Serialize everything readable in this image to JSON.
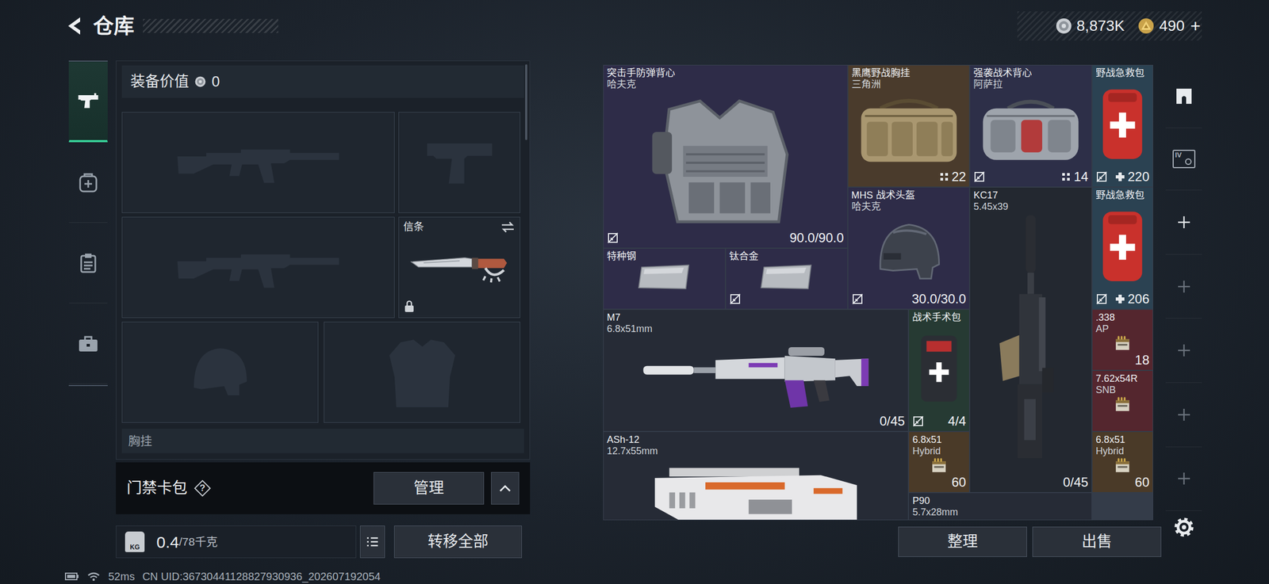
{
  "header": {
    "title": "仓库"
  },
  "currency": [
    {
      "kind": "silver",
      "amount": "8,873K"
    },
    {
      "kind": "gold",
      "amount": "490",
      "action": "+"
    }
  ],
  "sidebar": {
    "items": [
      {
        "kind": "weapon",
        "selected": true
      },
      {
        "kind": "supplies",
        "selected": false
      },
      {
        "kind": "gear",
        "selected": false
      },
      {
        "kind": "case",
        "selected": false
      }
    ]
  },
  "loadout": {
    "value_label": "装备价值",
    "value": "0",
    "slots": [
      {
        "kind": "rifle",
        "locked": false
      },
      {
        "kind": "pistol",
        "locked": false
      },
      {
        "kind": "rifle",
        "locked": false
      },
      {
        "kind": "melee",
        "label": "信条",
        "locked": true
      },
      {
        "kind": "helmet",
        "locked": false
      },
      {
        "kind": "armor",
        "locked": false
      }
    ],
    "next_section": "胸挂"
  },
  "keycard": {
    "label": "门禁卡包",
    "help": "?",
    "button": "管理"
  },
  "weight": {
    "icon_text": "KG",
    "value": "0.4",
    "capacity": "/78千克"
  },
  "transfer_button": "转移全部",
  "inventory": {
    "items": [
      {
        "name": "突击手防弹背心",
        "sub": "哈夫克",
        "kind": "vest",
        "count": "90.0/90.0",
        "count_kind": "plain",
        "bound": true,
        "color": "#2e2c48"
      },
      {
        "name": "黑鹰野战胸挂",
        "sub": "三角洲",
        "kind": "rig",
        "count": "22",
        "count_kind": "capacity",
        "bound": false,
        "color": "#4a3b2c"
      },
      {
        "name": "强袭战术背心",
        "sub": "阿萨拉",
        "kind": "bag",
        "count": "14",
        "count_kind": "capacity",
        "bound": true,
        "color": "#2d2f48"
      },
      {
        "name": "野战急救包",
        "kind": "medkit",
        "count": "220",
        "count_kind": "heal",
        "bound": true,
        "color": "#2b4252"
      },
      {
        "name": "特种钢",
        "kind": "plate",
        "bound": false,
        "color": "#2e2c48"
      },
      {
        "name": "钛合金",
        "kind": "plate",
        "bound": true,
        "color": "#2e2c48"
      },
      {
        "name": "MHS 战术头盔",
        "sub": "哈夫克",
        "kind": "helmet",
        "count": "30.0/30.0",
        "count_kind": "plain",
        "bound": true,
        "color": "#2e2c48"
      },
      {
        "name": "KC17",
        "sub": "5.45x39",
        "kind": "vrifle",
        "count": "0/45",
        "count_kind": "plain",
        "bound": false,
        "color": "#232830"
      },
      {
        "name": "野战急救包",
        "kind": "medkit",
        "count": "206",
        "count_kind": "heal",
        "bound": true,
        "color": "#2b4252"
      },
      {
        "name": "M7",
        "sub": "6.8x51mm",
        "kind": "rifle",
        "count": "0/45",
        "count_kind": "plain",
        "bound": false,
        "color": "#262b36"
      },
      {
        "name": "战术手术包",
        "kind": "surgkit",
        "count": "4/4",
        "count_kind": "plain",
        "bound": true,
        "color": "#263a33"
      },
      {
        "name": ".338",
        "sub": "AP",
        "kind": "ammo",
        "count": "18",
        "count_kind": "plain",
        "bound": false,
        "color": "#54262e"
      },
      {
        "name": "7.62x54R",
        "sub": "SNB",
        "kind": "ammo",
        "bound": false,
        "color": "#54262e"
      },
      {
        "name": "ASh-12",
        "sub": "12.7x55mm",
        "kind": "bullpup",
        "bound": false,
        "color": "#262b36"
      },
      {
        "name": "6.8x51",
        "sub": "Hybrid",
        "kind": "ammo",
        "count": "60",
        "count_kind": "plain",
        "bound": false,
        "color": "#4a3a28"
      },
      {
        "name": "6.8x51",
        "sub": "Hybrid",
        "kind": "ammo",
        "count": "60",
        "count_kind": "plain",
        "bound": false,
        "color": "#4a3a28"
      },
      {
        "name": "P90",
        "sub": "5.7x28mm",
        "kind": "smg",
        "bound": false,
        "color": "#262b36"
      }
    ]
  },
  "toolbar": {
    "items": [
      {
        "kind": "home",
        "disabled": false
      },
      {
        "kind": "card",
        "label": "IV",
        "disabled": false
      },
      {
        "kind": "add",
        "disabled": false
      },
      {
        "kind": "add",
        "disabled": true
      },
      {
        "kind": "add",
        "disabled": true
      },
      {
        "kind": "add",
        "disabled": true
      },
      {
        "kind": "add",
        "disabled": true
      },
      {
        "kind": "settings",
        "disabled": false
      }
    ]
  },
  "buttons": [
    "整理",
    "出售"
  ],
  "status_bar": {
    "ping": "52ms",
    "uid": "CN UID:36730441128827930936_202607192054"
  }
}
